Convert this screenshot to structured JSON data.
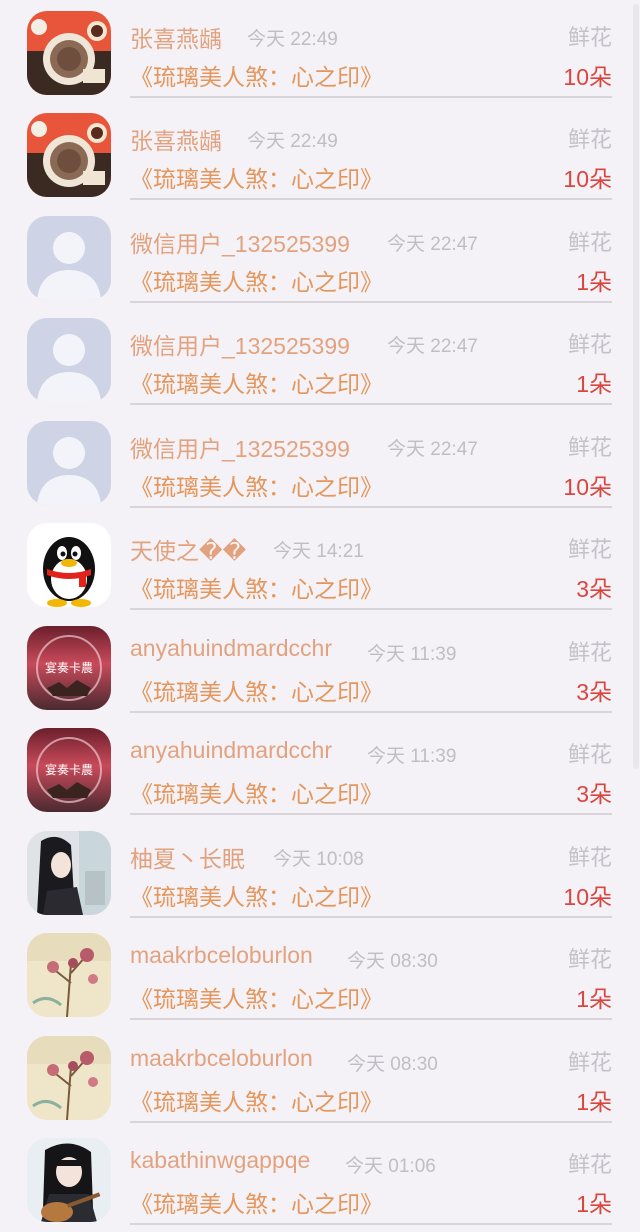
{
  "gift_list": {
    "items": [
      {
        "name": "张喜燕龋",
        "time": "今天 22:49",
        "gift": "鲜花",
        "book": "《琉璃美人煞：心之印》",
        "count": "10朵",
        "avatar": "food-avatar-icon"
      },
      {
        "name": "张喜燕龋",
        "time": "今天 22:49",
        "gift": "鲜花",
        "book": "《琉璃美人煞：心之印》",
        "count": "10朵",
        "avatar": "food-avatar-icon"
      },
      {
        "name": "微信用户_132525399",
        "time": "今天 22:47",
        "gift": "鲜花",
        "book": "《琉璃美人煞：心之印》",
        "count": "1朵",
        "avatar": "default-user-avatar-icon"
      },
      {
        "name": "微信用户_132525399",
        "time": "今天 22:47",
        "gift": "鲜花",
        "book": "《琉璃美人煞：心之印》",
        "count": "1朵",
        "avatar": "default-user-avatar-icon"
      },
      {
        "name": "微信用户_132525399",
        "time": "今天 22:47",
        "gift": "鲜花",
        "book": "《琉璃美人煞：心之印》",
        "count": "10朵",
        "avatar": "default-user-avatar-icon"
      },
      {
        "name": "天使之��",
        "time": "今天 14:21",
        "gift": "鲜花",
        "book": "《琉璃美人煞：心之印》",
        "count": "3朵",
        "avatar": "qq-penguin-avatar-icon"
      },
      {
        "name": "anyahuindmardcchr",
        "time": "今天 11:39",
        "gift": "鲜花",
        "book": "《琉璃美人煞：心之印》",
        "count": "3朵",
        "avatar": "red-sky-avatar-icon",
        "avatar_text": "宴奏卡農"
      },
      {
        "name": "anyahuindmardcchr",
        "time": "今天 11:39",
        "gift": "鲜花",
        "book": "《琉璃美人煞：心之印》",
        "count": "3朵",
        "avatar": "red-sky-avatar-icon",
        "avatar_text": "宴奏卡農"
      },
      {
        "name": "柚夏丶长眠",
        "time": "今天 10:08",
        "gift": "鲜花",
        "book": "《琉璃美人煞：心之印》",
        "count": "10朵",
        "avatar": "anime-character-avatar-icon"
      },
      {
        "name": "maakrbceloburlon",
        "time": "今天 08:30",
        "gift": "鲜花",
        "book": "《琉璃美人煞：心之印》",
        "count": "1朵",
        "avatar": "flower-painting-avatar-icon"
      },
      {
        "name": "maakrbceloburlon",
        "time": "今天 08:30",
        "gift": "鲜花",
        "book": "《琉璃美人煞：心之印》",
        "count": "1朵",
        "avatar": "flower-painting-avatar-icon"
      },
      {
        "name": "kabathinwgappqe",
        "time": "今天 01:06",
        "gift": "鲜花",
        "book": "《琉璃美人煞：心之印》",
        "count": "1朵",
        "avatar": "girl-guitar-avatar-icon"
      }
    ]
  },
  "colors": {
    "name": "#e3a27f",
    "book": "#e4965c",
    "count": "#d9463f",
    "time": "#c2bdc4",
    "gift": "#c6c1c8",
    "background": "#f4f2f6"
  }
}
